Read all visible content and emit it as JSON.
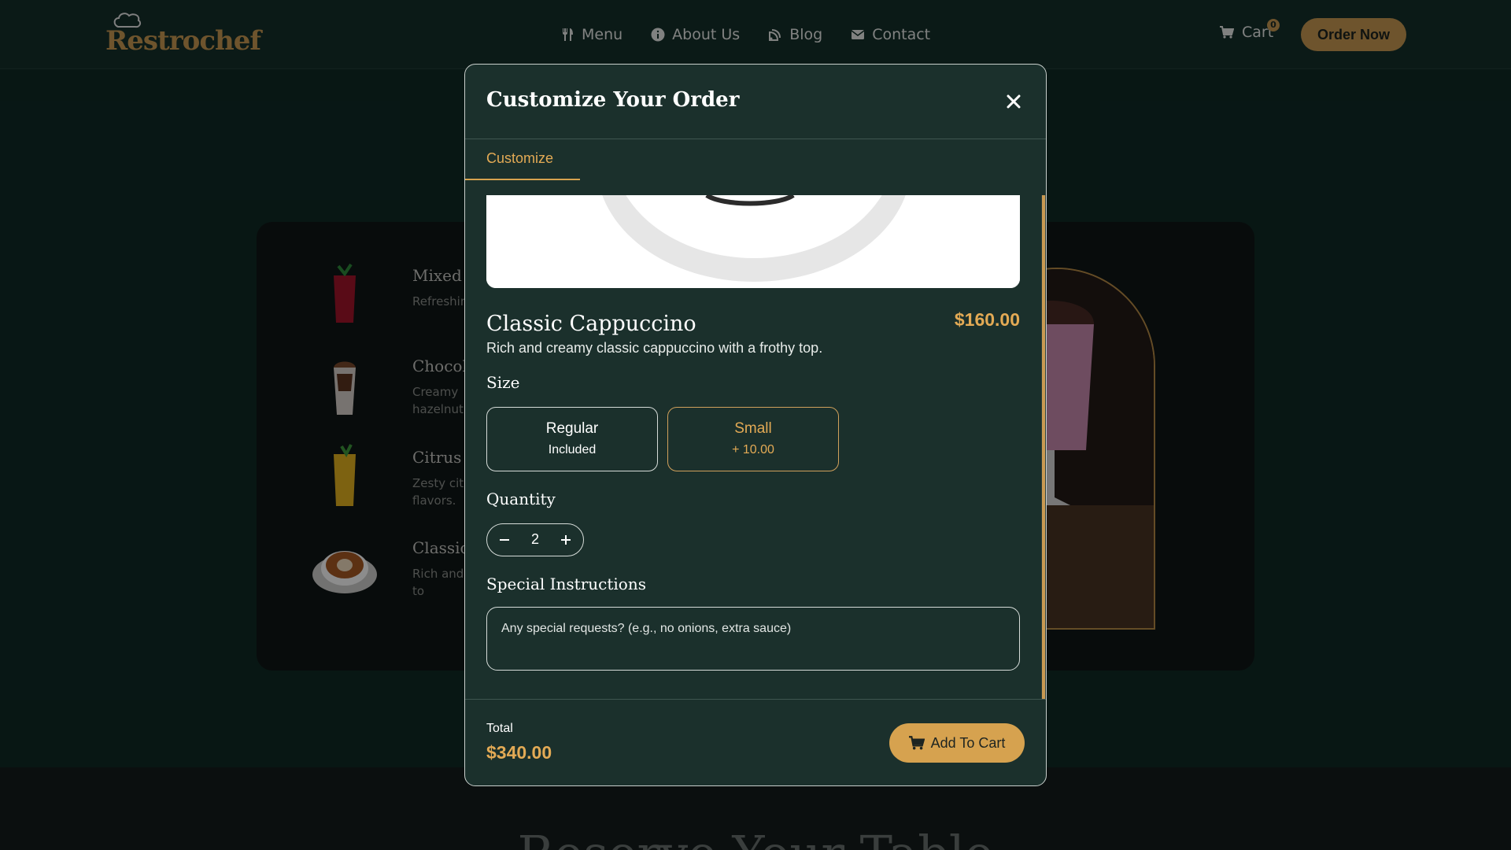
{
  "brand": {
    "name": "Restrochef",
    "accent_color": "#c99a52"
  },
  "nav": {
    "items": [
      {
        "label": "Menu",
        "icon": "utensils-icon"
      },
      {
        "label": "About Us",
        "icon": "info-icon"
      },
      {
        "label": "Blog",
        "icon": "blog-icon"
      },
      {
        "label": "Contact",
        "icon": "envelope-icon"
      }
    ],
    "cart_label": "Cart",
    "cart_count": "0",
    "order_now": "Order Now"
  },
  "menu_items": [
    {
      "name": "Mixed B",
      "desc": "Refreshin twist."
    },
    {
      "name": "Chocola",
      "desc": "Creamy hazelnut"
    },
    {
      "name": "Citrus B",
      "desc": "Zesty citr flavors."
    },
    {
      "name": "Classic",
      "desc": "Rich and frothy to"
    }
  ],
  "section_heading": "Reserve Your Table",
  "modal": {
    "title": "Customize Your Order",
    "tab": "Customize",
    "product": {
      "name": "Classic Cappuccino",
      "price": "$160.00",
      "description": "Rich and creamy classic cappuccino with a frothy top."
    },
    "size_label": "Size",
    "sizes": [
      {
        "name": "Regular",
        "note": "Included",
        "selected": false
      },
      {
        "name": "Small",
        "note": "+ 10.00",
        "selected": true
      }
    ],
    "quantity_label": "Quantity",
    "quantity": "2",
    "instructions_label": "Special Instructions",
    "instructions_placeholder": "Any special requests? (e.g., no onions, extra sauce)",
    "total_label": "Total",
    "total_value": "$340.00",
    "add_to_cart": "Add To Cart"
  }
}
